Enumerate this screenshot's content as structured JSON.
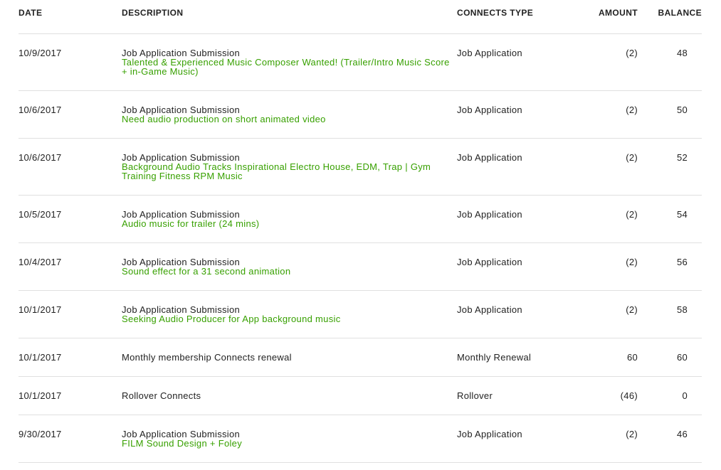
{
  "headers": {
    "date": "DATE",
    "description": "DESCRIPTION",
    "type": "CONNECTS TYPE",
    "amount": "AMOUNT",
    "balance": "BALANCE"
  },
  "accent_color": "#37a000",
  "rows": [
    {
      "date": "10/9/2017",
      "description": "Job Application Submission",
      "job": "Talented & Experienced Music Composer Wanted! (Trailer/Intro Music Score + in-Game Music)",
      "type": "Job Application",
      "amount": "(2)",
      "balance": "48"
    },
    {
      "date": "10/6/2017",
      "description": "Job Application Submission",
      "job": "Need audio production on short animated video",
      "type": "Job Application",
      "amount": "(2)",
      "balance": "50"
    },
    {
      "date": "10/6/2017",
      "description": "Job Application Submission",
      "job": "Background Audio Tracks Inspirational Electro House, EDM, Trap | Gym Training Fitness RPM Music",
      "type": "Job Application",
      "amount": "(2)",
      "balance": "52"
    },
    {
      "date": "10/5/2017",
      "description": "Job Application Submission",
      "job": "Audio music for trailer (24 mins)",
      "type": "Job Application",
      "amount": "(2)",
      "balance": "54"
    },
    {
      "date": "10/4/2017",
      "description": "Job Application Submission",
      "job": "Sound effect for a 31 second animation",
      "type": "Job Application",
      "amount": "(2)",
      "balance": "56"
    },
    {
      "date": "10/1/2017",
      "description": "Job Application Submission",
      "job": "Seeking Audio Producer for App background music",
      "type": "Job Application",
      "amount": "(2)",
      "balance": "58"
    },
    {
      "date": "10/1/2017",
      "description": "Monthly membership Connects renewal",
      "job": null,
      "type": "Monthly Renewal",
      "amount": "60",
      "balance": "60"
    },
    {
      "date": "10/1/2017",
      "description": "Rollover Connects",
      "job": null,
      "type": "Rollover",
      "amount": "(46)",
      "balance": "0"
    },
    {
      "date": "9/30/2017",
      "description": "Job Application Submission",
      "job": "FILM Sound Design + Foley",
      "type": "Job Application",
      "amount": "(2)",
      "balance": "46"
    }
  ]
}
